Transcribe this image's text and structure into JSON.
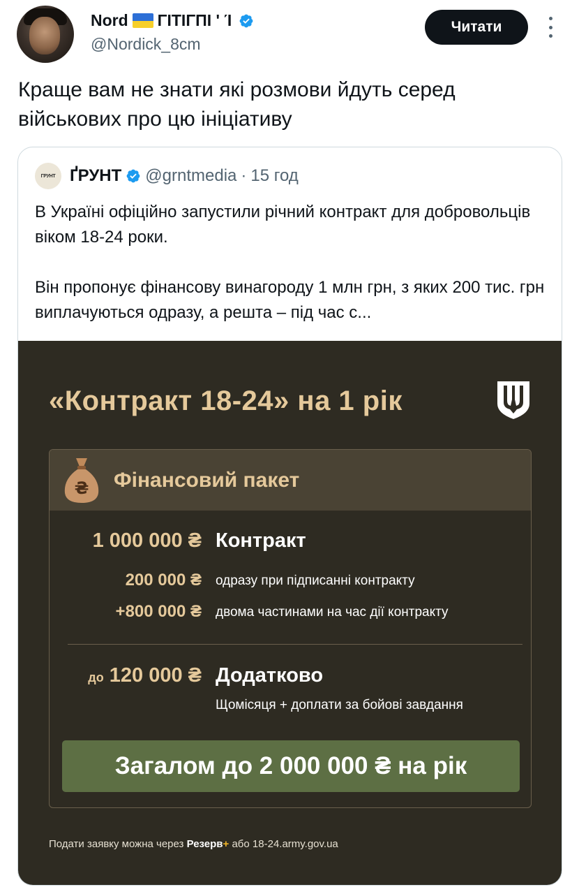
{
  "author": {
    "display_name": "Nord",
    "name_suffix": "ΓΙΤΙΓΠΙ ' Ί",
    "handle": "@Nordick_8cm",
    "follow_label": "Читати"
  },
  "tweet": {
    "text": "Краще вам не знати які розмови йдуть серед військових про цю ініціативу"
  },
  "quote": {
    "logo_text": "ГРУНТ",
    "name": "ҐРУНТ",
    "handle": "@grntmedia",
    "separator": "·",
    "time": "15 год",
    "paragraph1": "В Україні офіційно запустили річний контракт для добровольців віком 18-24 роки.",
    "paragraph2": "Він пропонує фінансову винагороду 1 млн грн, з яких 200 тис. грн виплачуються одразу, а решта – під час с..."
  },
  "graphic": {
    "title": "«Контракт 18-24» на 1 рік",
    "panel_title": "Фінансовий пакет",
    "contract_amount": "1 000 000 ₴",
    "contract_label": "Контракт",
    "upfront_amount": "200 000 ₴",
    "upfront_label": "одразу при підписанні контракту",
    "installments_amount": "+800 000 ₴",
    "installments_label": "двома частинами на час дії контракту",
    "extra_prefix": "до",
    "extra_amount": "120 000 ₴",
    "extra_label": "Додатково",
    "extra_sublabel": "Щомісяця + доплати за бойові завдання",
    "total": "Загалом до 2 000 000 ₴ на рік",
    "footer_prefix": "Подати заявку можна через",
    "footer_app": "Резерв",
    "footer_plus": "+",
    "footer_middle": "або",
    "footer_url": "18-24.army.gov.ua"
  },
  "colors": {
    "follow_bg": "#0f1419",
    "verified_blue": "#1d9bf0",
    "graphic_bg": "#2e2b22",
    "gold_text": "#e5c99b",
    "total_bg": "#5d6f44"
  }
}
